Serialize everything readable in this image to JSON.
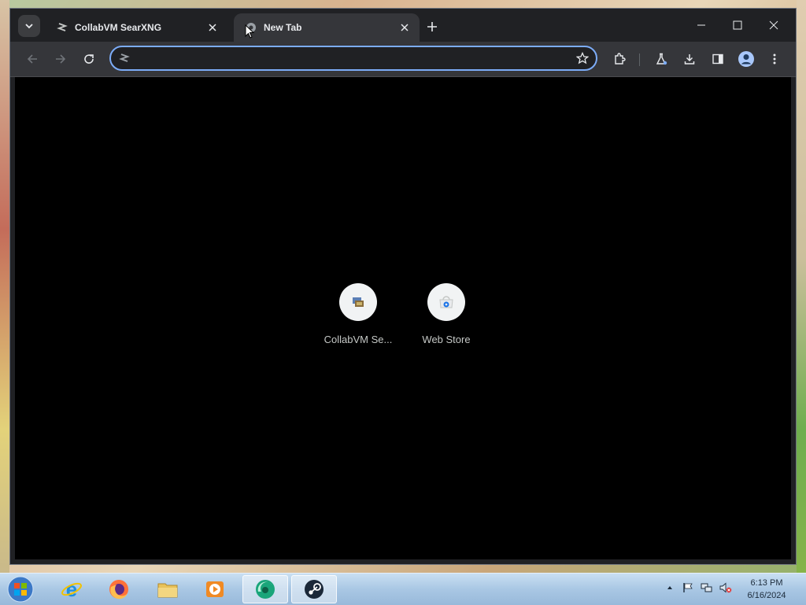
{
  "browser": {
    "tabs": [
      {
        "title": "CollabVM SearXNG",
        "active": false
      },
      {
        "title": "New Tab",
        "active": true
      }
    ],
    "omnibox": {
      "value": "",
      "placeholder": ""
    },
    "shortcuts": [
      {
        "label": "CollabVM Se...",
        "icon": "collabvm-icon"
      },
      {
        "label": "Web Store",
        "icon": "web-store-icon"
      }
    ]
  },
  "taskbar": {
    "apps": [
      "internet-explorer",
      "firefox",
      "file-explorer",
      "media-player",
      "browser",
      "steam"
    ],
    "clock_time": "6:13 PM",
    "clock_date": "6/16/2024"
  },
  "colors": {
    "accent": "#7cacf8",
    "page_bg": "#000000",
    "chrome_bg": "#202124",
    "toolbar_bg": "#35363a"
  }
}
